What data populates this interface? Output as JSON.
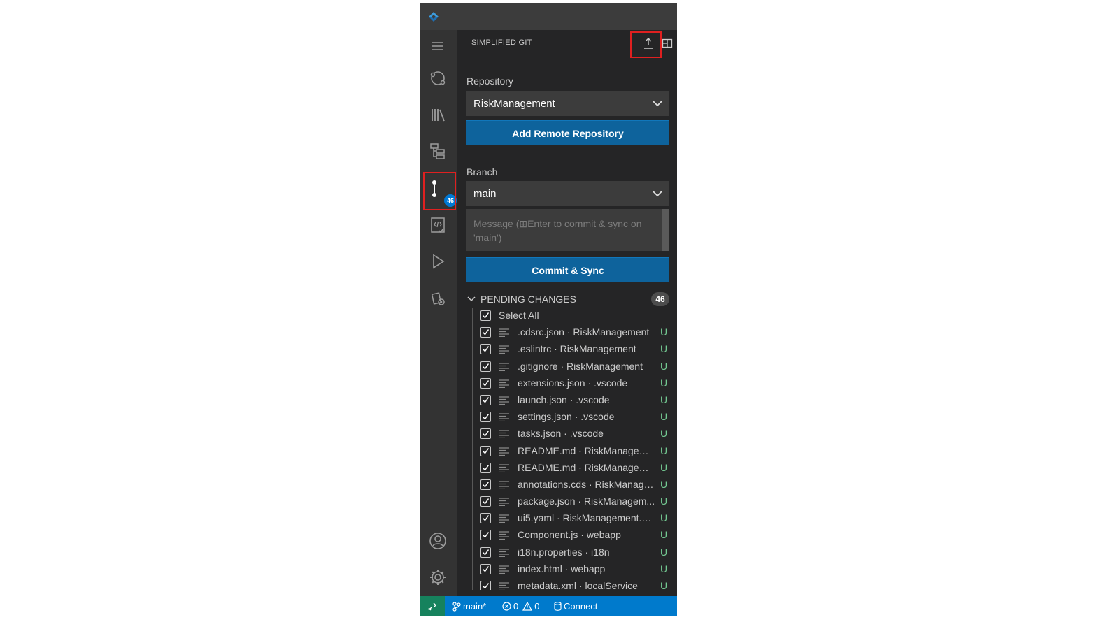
{
  "panel": {
    "title": "SIMPLIFIED GIT"
  },
  "repository": {
    "label": "Repository",
    "selected": "RiskManagement",
    "add_remote_label": "Add Remote Repository"
  },
  "branch": {
    "label": "Branch",
    "selected": "main"
  },
  "commit": {
    "message_value": "",
    "message_placeholder": "Message (⊞Enter to commit & sync on 'main')",
    "button_label": "Commit & Sync"
  },
  "activity_bar": {
    "scm_badge": "46",
    "icons": [
      "explorer-circle-icon",
      "library-icon",
      "hierarchy-icon",
      "source-control-icon",
      "code-check-icon",
      "run-icon",
      "extensions-gear-icon",
      "account-icon",
      "settings-gear-icon"
    ]
  },
  "pending": {
    "title": "PENDING CHANGES",
    "count": "46",
    "select_all_label": "Select All",
    "files": [
      {
        "name": ".cdsrc.json · RiskManagement",
        "status": "U"
      },
      {
        "name": ".eslintrc · RiskManagement",
        "status": "U"
      },
      {
        "name": ".gitignore · RiskManagement",
        "status": "U"
      },
      {
        "name": "extensions.json · .vscode",
        "status": "U"
      },
      {
        "name": "launch.json · .vscode",
        "status": "U"
      },
      {
        "name": "settings.json · .vscode",
        "status": "U"
      },
      {
        "name": "tasks.json · .vscode",
        "status": "U"
      },
      {
        "name": "README.md · RiskManageme...",
        "status": "U"
      },
      {
        "name": "README.md · RiskManageme...",
        "status": "U"
      },
      {
        "name": "annotations.cds · RiskManage...",
        "status": "U"
      },
      {
        "name": "package.json · RiskManagem...",
        "status": "U"
      },
      {
        "name": "ui5.yaml · RiskManagement.R...",
        "status": "U"
      },
      {
        "name": "Component.js · webapp",
        "status": "U"
      },
      {
        "name": "i18n.properties · i18n",
        "status": "U"
      },
      {
        "name": "index.html · webapp",
        "status": "U"
      },
      {
        "name": "metadata.xml · localService",
        "status": "U"
      }
    ]
  },
  "statusbar": {
    "branch": "main*",
    "errors": "0",
    "warnings": "0",
    "connect_label": "Connect"
  },
  "colors": {
    "accent_button": "#0e639c",
    "status_bar": "#007acc",
    "untracked": "#73c991",
    "highlight": "#e02020"
  }
}
